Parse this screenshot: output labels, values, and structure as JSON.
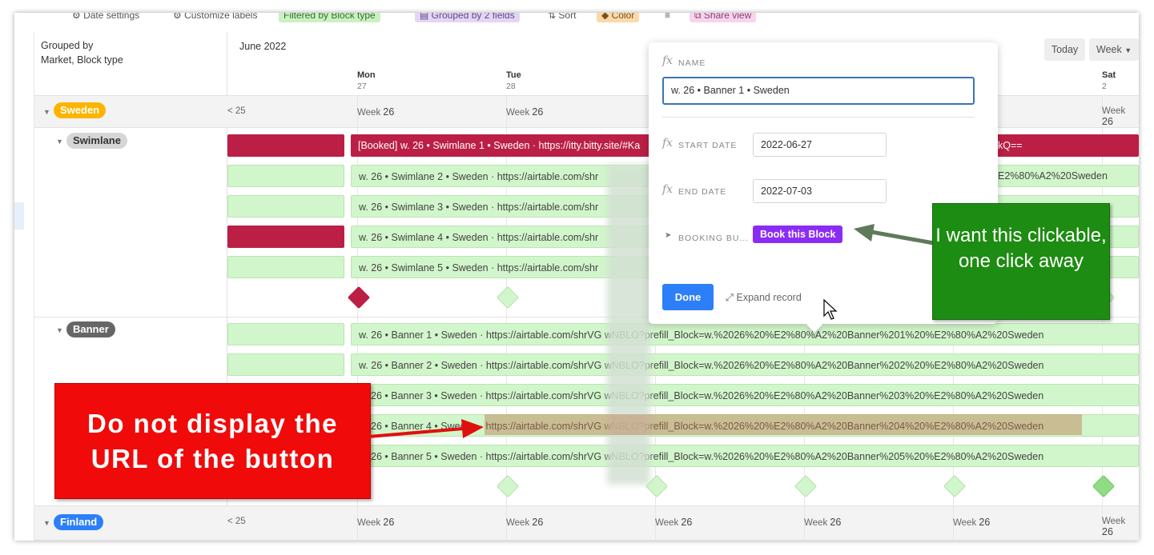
{
  "toolbar": {
    "date_settings": "Date settings",
    "customize_labels": "Customize labels",
    "filtered": "Filtered by Block type",
    "grouped": "Grouped by 2 fields",
    "sort": "Sort",
    "color": "Color",
    "share_view": "Share view"
  },
  "sidebar": {
    "grouped_title": "Grouped by",
    "grouped_sub": "Market, Block type"
  },
  "timeline": {
    "month": "June 2022",
    "today_label": "Today",
    "view_label": "Week",
    "days": [
      {
        "name": "Mon",
        "num": "27"
      },
      {
        "name": "Tue",
        "num": "28"
      },
      {
        "name": "Sat",
        "num": "2"
      }
    ],
    "week_prefix": "Week",
    "week_num": "26",
    "prev_week_fragment": "< 25"
  },
  "groups": {
    "sweden": {
      "label": "Sweden",
      "color": "#fcb400"
    },
    "swimlane": {
      "label": "Swimlane"
    },
    "banner": {
      "label": "Banner"
    },
    "finland": {
      "label": "Finland",
      "color": "#2d7ff9"
    }
  },
  "swimlane_rows": [
    "[Booked] w. 26 • Swimlane 1 • Sweden · https://itty.bitty.site/#Ka",
    "w. 26 • Swimlane 2 • Sweden · https://airtable.com/shr",
    "w. 26 • Swimlane 3 • Sweden · https://airtable.com/shr",
    "w. 26 • Swimlane 4 • Sweden · https://airtable.com/shr",
    "w. 26 • Swimlane 5 • Sweden · https://airtable.com/shr"
  ],
  "swimlane_tail": {
    "row1": "kQ==",
    "row2": "E2%80%A2%20Sweden"
  },
  "banner_rows": [
    "w. 26 • Banner 1 • Sweden · https://airtable.com/shrVG          wNBLO?prefill_Block=w.%2026%20%E2%80%A2%20Banner%201%20%E2%80%A2%20Sweden",
    "w. 26 • Banner 2 • Sweden · https://airtable.com/shrVG          wNBLO?prefill_Block=w.%2026%20%E2%80%A2%20Banner%202%20%E2%80%A2%20Sweden",
    "26 • Banner 3 • Sweden · https://airtable.com/shrVG          wNBLO?prefill_Block=w.%2026%20%E2%80%A2%20Banner%203%20%E2%80%A2%20Sweden",
    "26 • Banner 4 • Sweden · https://airtable.com/shrVG          wNBLO?prefill_Block=w.%2026%20%E2%80%A2%20Banner%204%20%E2%80%A2%20Sweden",
    "26 • Banner 5 • Sweden · https://airtable.com/shrVG          wNBLO?prefill_Block=w.%2026%20%E2%80%A2%20Banner%205%20%E2%80%A2%20Sweden"
  ],
  "popup": {
    "name_label": "NAME",
    "name_value": "w. 26 • Banner 1 • Sweden",
    "start_label": "START DATE",
    "start_value": "2022-06-27",
    "end_label": "END DATE",
    "end_value": "2022-07-03",
    "booking_label": "BOOKING BU...",
    "book_button": "Book this Block",
    "done_button": "Done",
    "expand_record": "Expand record"
  },
  "annotations": {
    "green_note": "I want this clickable, one click away",
    "red_note": "Do not display the URL of the button"
  },
  "colors": {
    "booked_red": "#bb1f45",
    "event_green": "#d2f6cb",
    "book_purple": "#8b2cf5",
    "done_blue": "#2d7ff9"
  }
}
